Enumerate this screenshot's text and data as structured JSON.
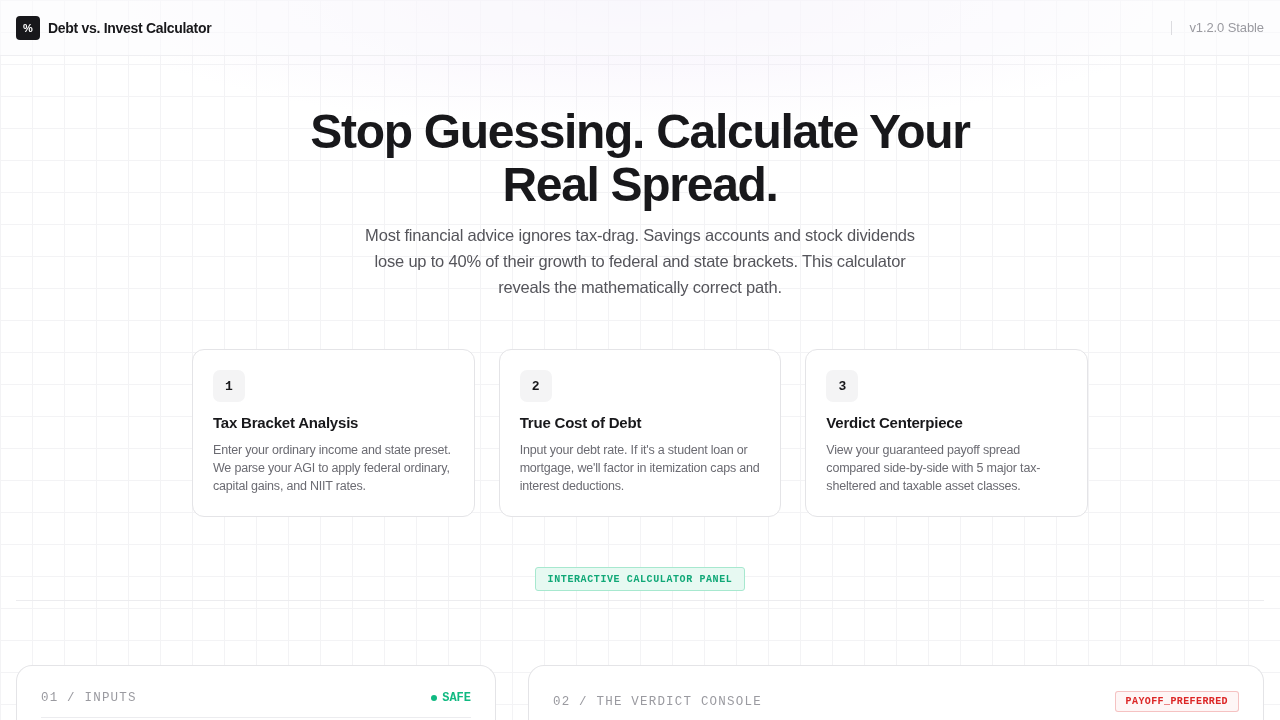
{
  "header": {
    "logo": "%",
    "title": "Debt vs. Invest Calculator",
    "version": "v1.2.0 Stable"
  },
  "hero": {
    "title": "Stop Guessing. Calculate Your Real Spread.",
    "description": "Most financial advice ignores tax-drag. Savings accounts and stock dividends lose up to 40% of their growth to federal and state brackets. This calculator reveals the mathematically correct path."
  },
  "steps": [
    {
      "number": "1",
      "title": "Tax Bracket Analysis",
      "description": "Enter your ordinary income and state preset. We parse your AGI to apply federal ordinary, capital gains, and NIIT rates."
    },
    {
      "number": "2",
      "title": "True Cost of Debt",
      "description": "Input your debt rate. If it's a student loan or mortgage, we'll factor in itemization caps and interest deductions."
    },
    {
      "number": "3",
      "title": "Verdict Centerpiece",
      "description": "View your guaranteed payoff spread compared side-by-side with 5 major tax-sheltered and taxable asset classes."
    }
  ],
  "section_label": "INTERACTIVE CALCULATOR PANEL",
  "panels": [
    {
      "title": "01 / INPUTS",
      "status": {
        "kind": "dot",
        "label": "SAFE",
        "color": "#10b981"
      }
    },
    {
      "title": "02 / THE VERDICT CONSOLE",
      "status": {
        "kind": "tag",
        "label": "PAYOFF_PREFERRED",
        "color": "#dc2626"
      }
    }
  ]
}
